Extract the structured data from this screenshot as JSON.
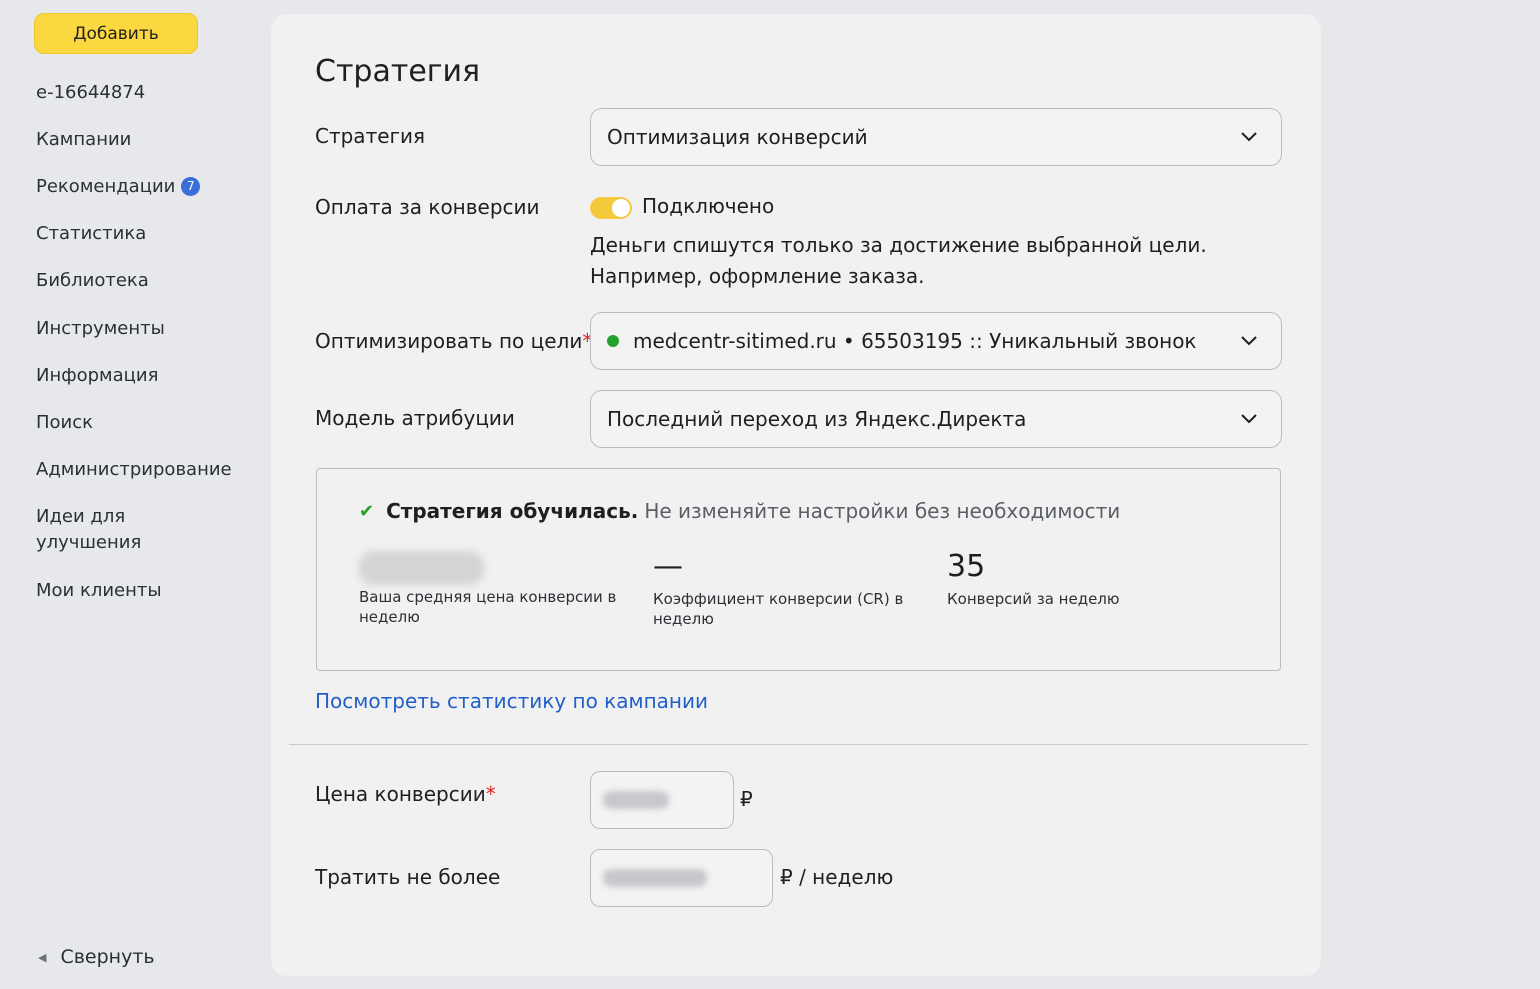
{
  "sidebar": {
    "add_button": "Добавить",
    "account": "e-16644874",
    "items": [
      {
        "label": "Кампании"
      },
      {
        "label": "Рекомендации",
        "badge": "7"
      },
      {
        "label": "Статистика"
      },
      {
        "label": "Библиотека"
      },
      {
        "label": "Инструменты"
      },
      {
        "label": "Информация"
      },
      {
        "label": "Поиск"
      },
      {
        "label": "Администрирование"
      },
      {
        "label": "Идеи для улучшения"
      },
      {
        "label": "Мои клиенты"
      }
    ],
    "collapse": "Свернуть"
  },
  "strategy": {
    "title": "Стратегия",
    "strategy_label": "Стратегия",
    "strategy_value": "Оптимизация конверсий",
    "pay_label": "Оплата за конверсии",
    "pay_toggle_label": "Подключено",
    "pay_toggle_on": true,
    "pay_description": "Деньги спишутся только за достижение выбранной цели. Например, оформление заказа.",
    "goal_label": "Оптимизировать по цели",
    "goal_required_mark": "*",
    "goal_value": "medcentr-sitimed.ru • 65503195 :: Уникальный звонок",
    "attribution_label": "Модель атрибуции",
    "attribution_value": "Последний переход из Яндекс.Директа"
  },
  "status_panel": {
    "status_bold": "Стратегия обучилась.",
    "status_text": "Не изменяйте настройки без необходимости",
    "metrics": [
      {
        "value": "",
        "caption": "Ваша средняя цена конверсии в неделю"
      },
      {
        "value": "—",
        "caption": "Коэффициент конверсии (CR) в неделю"
      },
      {
        "value": "35",
        "caption": "Конверсий за неделю"
      }
    ],
    "stats_link": "Посмотреть статистику по кампании"
  },
  "budget": {
    "price_label": "Цена конверсии",
    "price_required_mark": "*",
    "price_unit": "₽",
    "spend_label": "Тратить не более",
    "spend_unit": "₽ / неделю"
  }
}
